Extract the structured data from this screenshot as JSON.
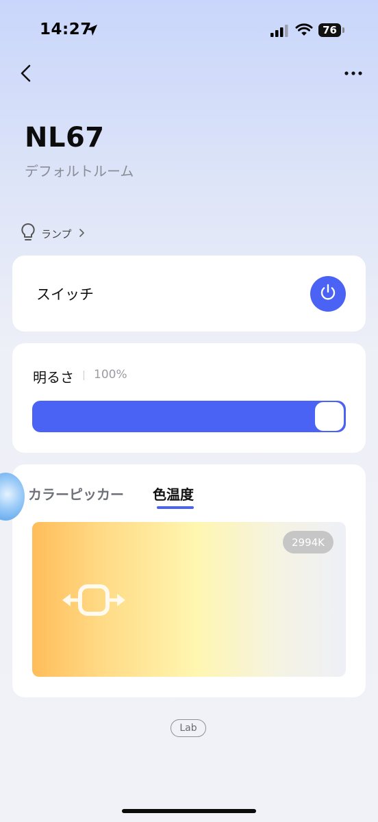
{
  "status_bar": {
    "time": "14:27",
    "battery": "76"
  },
  "header": {
    "title": "NL67",
    "room": "デフォルトルーム"
  },
  "device_type": {
    "label": "ランプ",
    "icon": "bulb-icon"
  },
  "switch": {
    "label": "スイッチ",
    "state": "on",
    "icon": "power-icon"
  },
  "brightness": {
    "label": "明るさ",
    "value_text": "100%",
    "value": 100
  },
  "color": {
    "tabs": [
      {
        "label": "カラーピッカー",
        "active": false
      },
      {
        "label": "色温度",
        "active": true
      }
    ],
    "temperature": "2994K"
  },
  "footer": {
    "lab_label": "Lab"
  },
  "colors": {
    "accent": "#4a63f5",
    "warm": "#ffbd5a",
    "neutral": "#eef0f7"
  }
}
